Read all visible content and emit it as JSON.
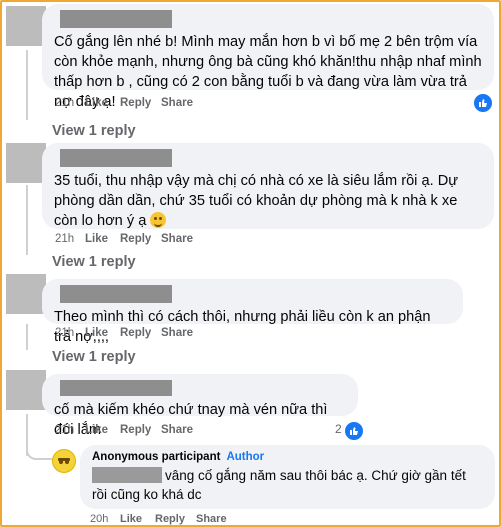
{
  "comments": [
    {
      "text": "Cố gắng lên nhé b! Mình may mắn hơn b vì bố mẹ 2 bên trộm vía còn khỏe mạnh, nhưng ông bà cũng khó khăn!thu nhập nhaf mình thấp hơn b , cũng có 2 con bằng tuổi b và đang vừa làm vừa trả nợ đây ạ!",
      "time": "21h",
      "like": "Like",
      "reply": "Reply",
      "share": "Share",
      "view_replies": "View 1 reply"
    },
    {
      "text": "35 tuổi, thu nhập vậy mà chị có nhà có xe là siêu lắm rồi ạ. Dự phòng dần dần, chứ 35 tuổi có khoản dự phòng mà k nhà k xe còn lo hơn ý ạ",
      "time": "21h",
      "like": "Like",
      "reply": "Reply",
      "share": "Share",
      "view_replies": "View 1 reply"
    },
    {
      "text": "Theo mình thì có cách thôi, nhưng phải liều còn k an phận trả nợ,,,,",
      "time": "21h",
      "like": "Like",
      "reply": "Reply",
      "share": "Share",
      "view_replies": "View 1 reply"
    },
    {
      "text": "cố mà kiếm khéo chứ tnay mà vén nữa thì đói lắm",
      "time": "21h",
      "like": "Like",
      "reply": "Reply",
      "share": "Share",
      "reaction_count": "2"
    }
  ],
  "reply": {
    "name": "Anonymous participant",
    "author_tag": "Author",
    "text": "vâng cố gắng năm sau thôi bác ạ. Chứ giờ gần tết rồi cũng ko khá dc",
    "time": "20h",
    "like": "Like",
    "reply": "Reply",
    "share": "Share"
  },
  "colors": {
    "accent": "#1877f2",
    "meta": "#65676b",
    "bubble": "#f0f2f5",
    "frame": "#f0a830"
  }
}
